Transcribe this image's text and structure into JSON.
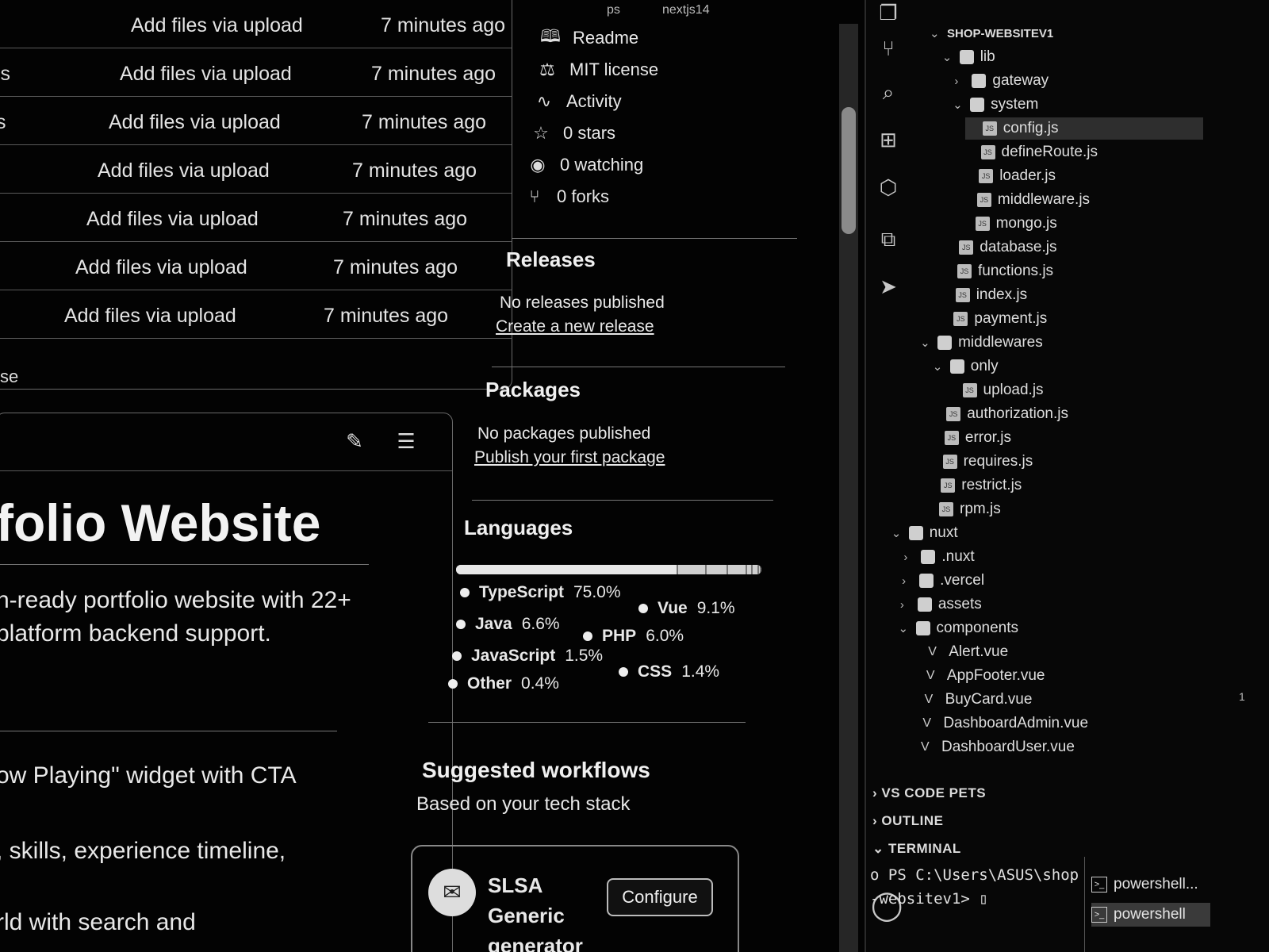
{
  "file_list": {
    "rows": [
      {
        "file": "",
        "message": "Add files via upload",
        "time": "7 minutes ago"
      },
      {
        "file": "js",
        "message": "Add files via upload",
        "time": "7 minutes ago"
      },
      {
        "file": "s",
        "message": "Add files via upload",
        "time": "7 minutes ago"
      },
      {
        "file": "",
        "message": "Add files via upload",
        "time": "7 minutes ago"
      },
      {
        "file": "",
        "message": "Add files via upload",
        "time": "7 minutes ago"
      },
      {
        "file": "",
        "message": "Add files via upload",
        "time": "7 minutes ago"
      },
      {
        "file": "",
        "message": "Add files via upload",
        "time": "7 minutes ago"
      }
    ],
    "below_text": "se"
  },
  "readme": {
    "title": "folio Website",
    "description": "n-ready portfolio website with 22+ platform backend support.",
    "feature_1": "ow Playing\" widget with CTA",
    "feature_2": ", skills, experience timeline,",
    "feature_3": "rld with search and",
    "edit_icon": "pencil-icon",
    "outline_icon": "list-icon"
  },
  "sidebar": {
    "top_label": "nextjs14",
    "top_label_left": "ps",
    "about_items": [
      {
        "icon": "book-icon",
        "label": "Readme"
      },
      {
        "icon": "scale-icon",
        "label": "MIT license"
      },
      {
        "icon": "pulse-icon",
        "label": "Activity"
      },
      {
        "icon": "star-icon",
        "label": "0 stars"
      },
      {
        "icon": "eye-icon",
        "label": "0 watching"
      },
      {
        "icon": "fork-icon",
        "label": "0 forks"
      }
    ],
    "releases": {
      "heading": "Releases",
      "text": "No releases published",
      "link": "Create a new release"
    },
    "packages": {
      "heading": "Packages",
      "text": "No packages published",
      "link": "Publish your first package"
    },
    "languages": {
      "heading": "Languages",
      "items": [
        {
          "name": "TypeScript",
          "percent": "75.0%",
          "value": 75.0
        },
        {
          "name": "Vue",
          "percent": "9.1%",
          "value": 9.1
        },
        {
          "name": "Java",
          "percent": "6.6%",
          "value": 6.6
        },
        {
          "name": "PHP",
          "percent": "6.0%",
          "value": 6.0
        },
        {
          "name": "JavaScript",
          "percent": "1.5%",
          "value": 1.5
        },
        {
          "name": "CSS",
          "percent": "1.4%",
          "value": 1.4
        },
        {
          "name": "Other",
          "percent": "0.4%",
          "value": 0.4
        }
      ]
    },
    "workflows": {
      "heading": "Suggested workflows",
      "subheading": "Based on your tech stack",
      "card_title": "SLSA Generic generator",
      "card_button": "Configure"
    }
  },
  "vscode": {
    "activity_icons": [
      "files-icon",
      "source-control-icon",
      "search-icon",
      "extensions-icon",
      "box-icon",
      "remote-icon",
      "send-icon",
      "account-icon"
    ],
    "tree": [
      {
        "label": "SHOP-WEBSITEV1",
        "kind": "root",
        "depth": 0,
        "chev": "down"
      },
      {
        "label": "lib",
        "kind": "folder",
        "depth": 1,
        "chev": "down"
      },
      {
        "label": "gateway",
        "kind": "folder",
        "depth": 2,
        "chev": "right"
      },
      {
        "label": "system",
        "kind": "folder",
        "depth": 2,
        "chev": "down"
      },
      {
        "label": "config.js",
        "kind": "js",
        "depth": 3,
        "selected": true
      },
      {
        "label": "defineRoute.js",
        "kind": "js",
        "depth": 3
      },
      {
        "label": "loader.js",
        "kind": "js",
        "depth": 3
      },
      {
        "label": "middleware.js",
        "kind": "js",
        "depth": 3
      },
      {
        "label": "mongo.js",
        "kind": "js",
        "depth": 3
      },
      {
        "label": "database.js",
        "kind": "js",
        "depth": 2
      },
      {
        "label": "functions.js",
        "kind": "js",
        "depth": 2
      },
      {
        "label": "index.js",
        "kind": "js",
        "depth": 2
      },
      {
        "label": "payment.js",
        "kind": "js",
        "depth": 2
      },
      {
        "label": "middlewares",
        "kind": "folder",
        "depth": 1,
        "chev": "down"
      },
      {
        "label": "only",
        "kind": "folder",
        "depth": 2,
        "chev": "down"
      },
      {
        "label": "upload.js",
        "kind": "js",
        "depth": 3
      },
      {
        "label": "authorization.js",
        "kind": "js",
        "depth": 2
      },
      {
        "label": "error.js",
        "kind": "js",
        "depth": 2
      },
      {
        "label": "requires.js",
        "kind": "js",
        "depth": 2
      },
      {
        "label": "restrict.js",
        "kind": "js",
        "depth": 2
      },
      {
        "label": "rpm.js",
        "kind": "js",
        "depth": 2
      },
      {
        "label": "nuxt",
        "kind": "folder",
        "depth": 0,
        "chev": "down"
      },
      {
        "label": ".nuxt",
        "kind": "folder",
        "depth": 1,
        "chev": "right"
      },
      {
        "label": ".vercel",
        "kind": "folder",
        "depth": 1,
        "chev": "right"
      },
      {
        "label": "assets",
        "kind": "folder",
        "depth": 1,
        "chev": "right"
      },
      {
        "label": "components",
        "kind": "folder",
        "depth": 1,
        "chev": "down"
      },
      {
        "label": "Alert.vue",
        "kind": "vue",
        "depth": 2
      },
      {
        "label": "AppFooter.vue",
        "kind": "vue",
        "depth": 2
      },
      {
        "label": "BuyCard.vue",
        "kind": "vue",
        "depth": 2
      },
      {
        "label": "DashboardAdmin.vue",
        "kind": "vue",
        "depth": 2
      },
      {
        "label": "DashboardUser.vue",
        "kind": "vue",
        "depth": 2
      }
    ],
    "panels": [
      "VS CODE PETS",
      "OUTLINE",
      "TERMINAL"
    ],
    "terminal_lines": [
      "o PS C:\\Users\\ASUS\\shop",
      "-websitev1> ▯"
    ],
    "terminal_tabs": [
      {
        "label": "powershell...",
        "active": false
      },
      {
        "label": "powershell",
        "active": true
      }
    ],
    "gutter_badge": "1"
  },
  "colors": {
    "background": "#030303",
    "text": "#e8e8e8",
    "border": "#6a6a6a"
  }
}
